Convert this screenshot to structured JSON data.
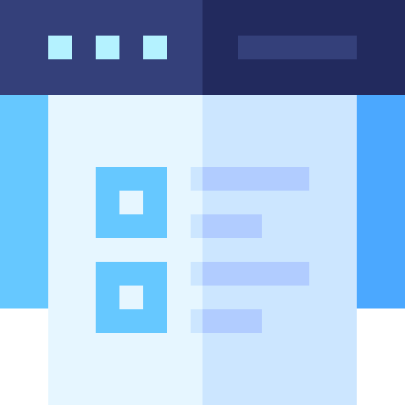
{
  "colors": {
    "title_bar_left": "#34407a",
    "title_bar_right": "#222a5e",
    "window_dot": "#b4f2ff",
    "address_bar": "#34407a",
    "side_left": "#66c8ff",
    "side_right": "#4ba8ff",
    "sheet_left": "#e6f6ff",
    "sheet_right": "#cce6ff",
    "checkbox": "#66c8ff",
    "checkbox_inner": "#e6f6ff",
    "line_left": "#cce6ff",
    "line_right": "#b1ccff"
  },
  "icons": {
    "window_controls": [
      "window-dot-icon",
      "window-dot-icon",
      "window-dot-icon"
    ],
    "address_bar": "address-bar-icon",
    "checklist_items": [
      "checkbox-icon",
      "checkbox-icon"
    ],
    "text_lines": [
      "text-line-icon",
      "text-line-icon",
      "text-line-icon",
      "text-line-icon"
    ]
  },
  "checklist": {
    "items": [
      {
        "checked": false
      },
      {
        "checked": false
      }
    ]
  }
}
